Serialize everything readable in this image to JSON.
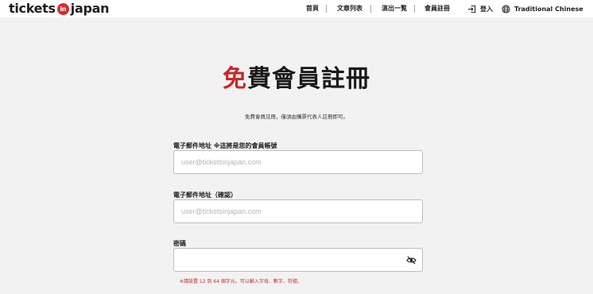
{
  "header": {
    "logo_left": "tickets",
    "logo_mid": "in",
    "logo_right": "japan",
    "nav": [
      "首頁",
      "文章列表",
      "演出一覧",
      "會員註冊"
    ],
    "login_label": "登入",
    "language_label": "Traditional Chinese"
  },
  "main": {
    "title_accent": "免",
    "title_rest": "費會員註冊",
    "subtitle": "免費會員註冊，僅須由購票代表人註冊即可。",
    "email_label": "電子郵件地址 ※這將是您的會員帳號",
    "email_placeholder": "user@ticketsinjapan.com",
    "email_confirm_label": "電子郵件地址（確認）",
    "email_confirm_placeholder": "user@ticketsinjapan.com",
    "password_label": "密碼",
    "password_hint": "※請設置 12 到 64 個字元。可以輸入字母、數字、符號。"
  },
  "colors": {
    "accent": "#c62a2a",
    "background": "#f2f2f2"
  }
}
